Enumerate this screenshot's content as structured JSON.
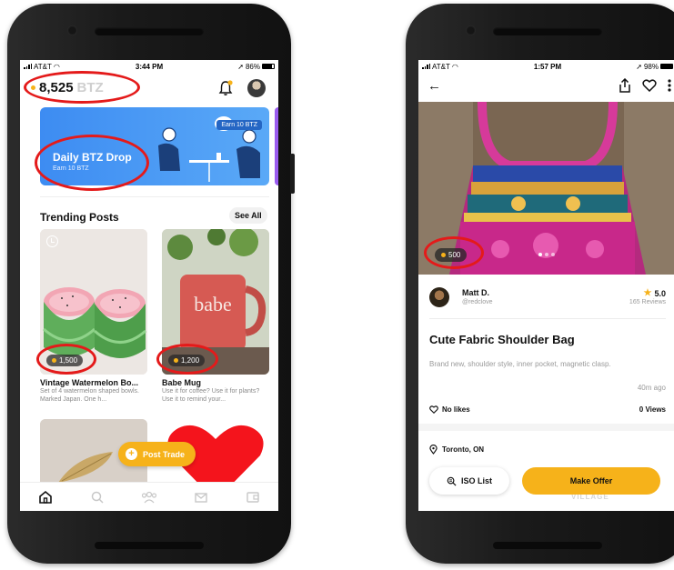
{
  "left_phone": {
    "status": {
      "carrier": "AT&T",
      "time": "3:44 PM",
      "battery": "86%"
    },
    "header": {
      "balance": "8,525",
      "balance_unit": "BTZ"
    },
    "banner": {
      "title": "Daily BTZ Drop",
      "subtitle": "Earn 10 BTZ",
      "chip": "Earn 10 BTZ"
    },
    "trending": {
      "title": "Trending Posts",
      "see_all": "See All",
      "posts": [
        {
          "price": "1,500",
          "name": "Vintage Watermelon Bo...",
          "desc": "Set of 4 watermelon shaped bowls. Marked Japan. One h..."
        },
        {
          "price": "1,200",
          "name": "Babe Mug",
          "desc": "Use it for coffee? Use it for plants? Use it to remind your...",
          "mug_text": "babe"
        }
      ]
    },
    "post_trade": "Post Trade",
    "tabs": [
      "home-icon",
      "search-icon",
      "community-icon",
      "mail-icon",
      "wallet-icon"
    ]
  },
  "right_phone": {
    "status": {
      "carrier": "AT&T",
      "time": "1:57 PM",
      "battery": "98%"
    },
    "hero_price": "500",
    "seller": {
      "name": "Matt D.",
      "handle": "@redclove",
      "rating": "5.0",
      "reviews": "165 Reviews"
    },
    "product": {
      "title": "Cute Fabric Shoulder Bag",
      "description": "Brand new, shoulder style, inner pocket, magnetic clasp.",
      "posted": "40m ago",
      "likes": "No likes",
      "views": "0 Views",
      "location": "Toronto, ON"
    },
    "ghost_text": "VILLAGE",
    "buttons": {
      "iso": "ISO List",
      "offer": "Make Offer"
    }
  },
  "colors": {
    "accent": "#f6b21a",
    "highlight": "#e41a1a",
    "banner": "#3d8cf2"
  }
}
